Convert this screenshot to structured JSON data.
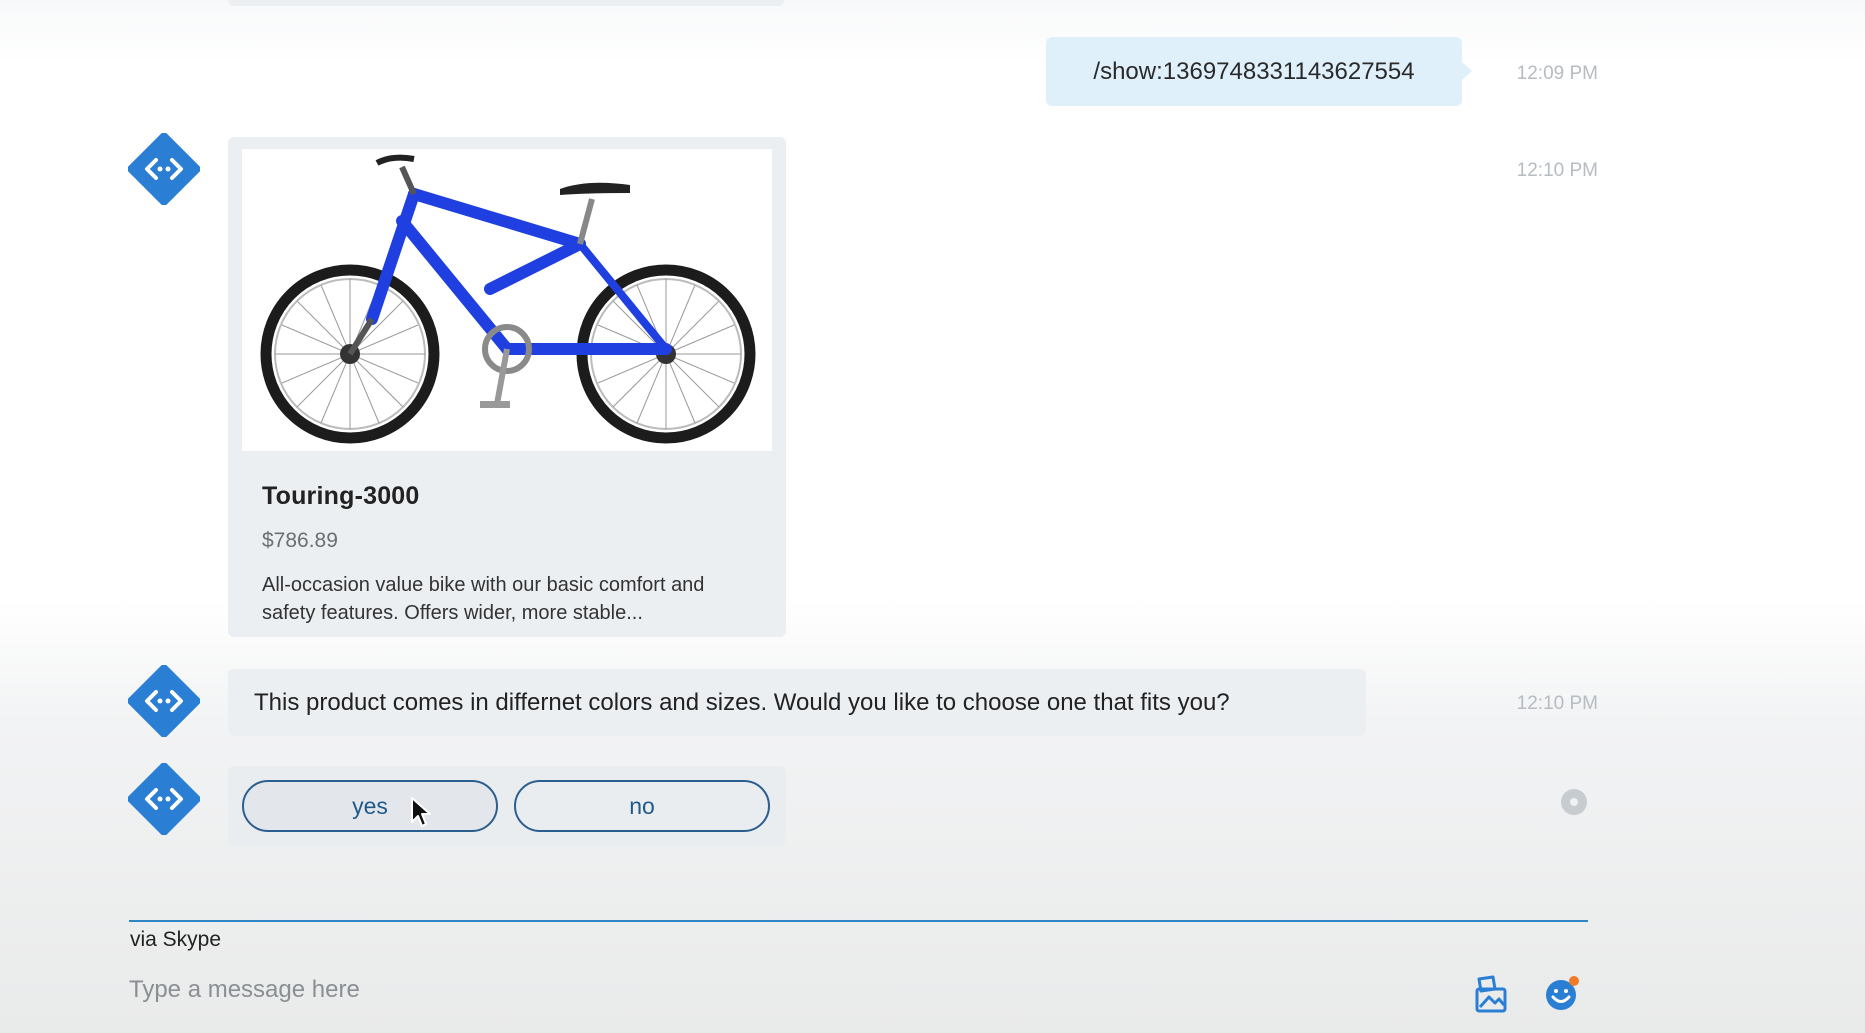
{
  "conversation": {
    "outgoing": {
      "text": "/show:1369748331143627554",
      "time": "12:09 PM"
    },
    "card": {
      "time": "12:10 PM",
      "image_icon": "bicycle-image",
      "title": "Touring-3000",
      "price": "$786.89",
      "description": "All-occasion value bike with our basic comfort and safety features. Offers wider, more stable..."
    },
    "message": {
      "text": "This product comes in differnet colors and sizes. Would you like to choose one that fits you?",
      "time": "12:10 PM"
    },
    "suggested_actions": {
      "yes_label": "yes",
      "no_label": "no"
    }
  },
  "compose": {
    "via": "via Skype",
    "placeholder": "Type a message here",
    "attach_icon": "image-attach-icon",
    "emoji_icon": "emoji-icon"
  },
  "colors": {
    "outgoing_bubble": "#dff0fb",
    "incoming_bubble": "#eceff2",
    "accent": "#2e86c4",
    "bot_avatar": "#2a7fd4"
  }
}
